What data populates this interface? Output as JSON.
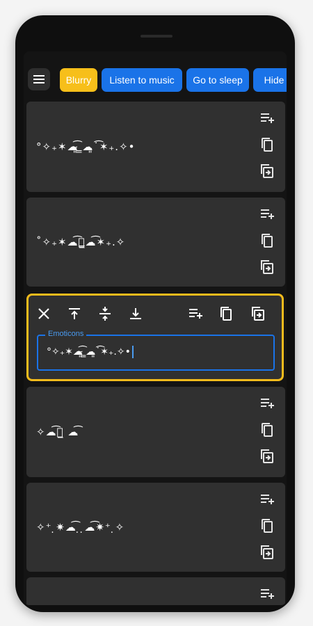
{
  "tabs": [
    {
      "label": "Blurry",
      "active": true
    },
    {
      "label": "Listen to music",
      "active": false
    },
    {
      "label": "Go to sleep",
      "active": false
    },
    {
      "label": "Hide",
      "active": false
    }
  ],
  "cards": [
    {
      "text": "°✧₊✶☁̴͈͡ ̳☁͈˙͡✶₊.✧•"
    },
    {
      "text": "˚✧₊✶☁͡⌒̳☁͡✶₊.✧"
    },
    {
      "text": "✧☁͡⌒̲ ☁͡"
    },
    {
      "text": "✧⁺ ̣✷☁͡ ̣ ̣☁͡✷⁺ ̣✧"
    },
    {
      "text": ""
    }
  ],
  "editor": {
    "label": "Emoticons",
    "value": "°✧₊✶☁̴͈͡ ̳☁͈˙͡✶₊.✧•"
  },
  "icons": {
    "menu": "menu-icon",
    "add_to_queue": "playlist-add-icon",
    "copy": "copy-icon",
    "insert": "insert-icon",
    "close": "close-icon",
    "move_top": "move-top-icon",
    "move_mid": "move-middle-icon",
    "move_bottom": "move-bottom-icon"
  },
  "colors": {
    "accent": "#f7bf1a",
    "tab_blue": "#1a73e8",
    "card_bg": "#303030",
    "screen_bg": "#141414"
  }
}
